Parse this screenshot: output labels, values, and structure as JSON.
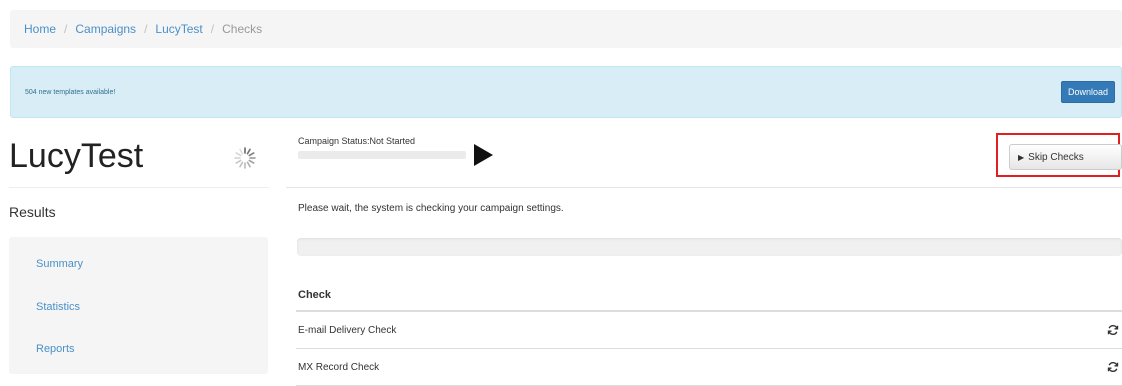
{
  "breadcrumb": {
    "items": [
      "Home",
      "Campaigns",
      "LucyTest"
    ],
    "current": "Checks",
    "separator": "/"
  },
  "alert": {
    "text": "504 new templates available!",
    "button_label": "Download"
  },
  "campaign": {
    "title": "LucyTest",
    "status_label": "Campaign Status:Not Started"
  },
  "toolbar": {
    "skip_label": "Skip Checks"
  },
  "sidebar": {
    "heading": "Results",
    "items": [
      "Summary",
      "Statistics",
      "Reports"
    ]
  },
  "main": {
    "wait_message": "Please wait, the system is checking your campaign settings."
  },
  "checks_table": {
    "header": "Check",
    "rows": [
      "E-mail Delivery Check",
      "MX Record Check"
    ]
  },
  "colors": {
    "link": "#4a90c8",
    "alert_bg": "#d9edf7",
    "primary_button": "#337ab7",
    "highlight": "#e02020"
  },
  "icons": {
    "spinner": "loading-spinner-icon",
    "play": "play-icon",
    "refresh": "refresh-icon"
  }
}
